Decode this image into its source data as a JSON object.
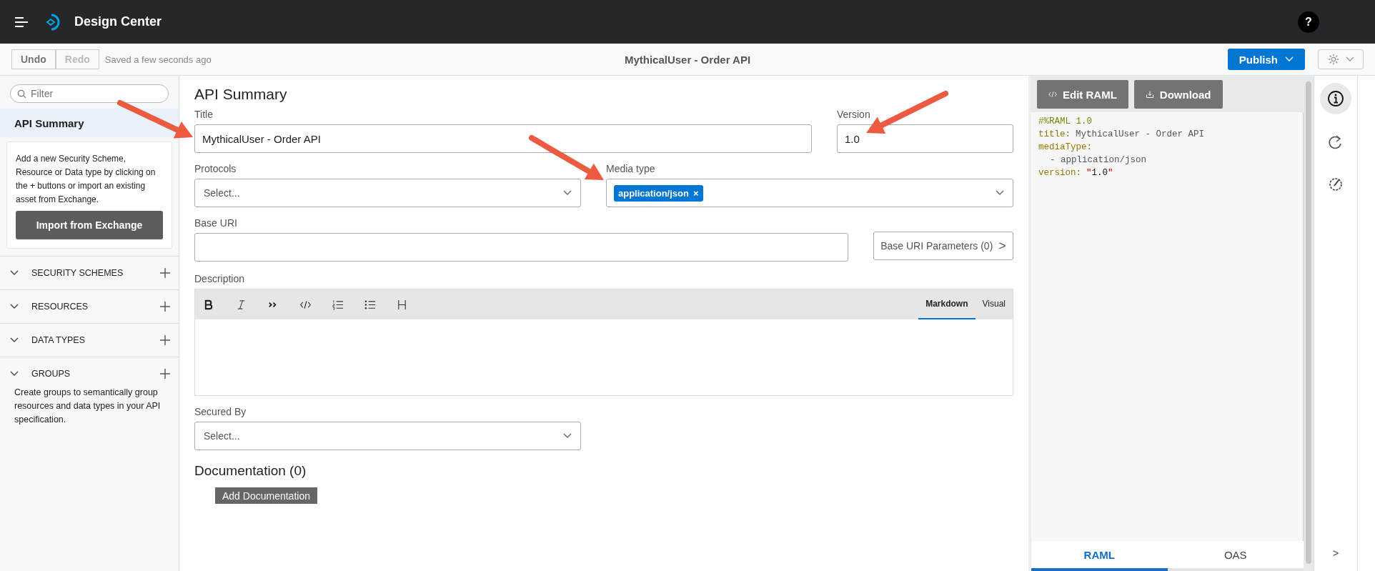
{
  "app": {
    "title": "Design Center",
    "help": "?"
  },
  "toolbar": {
    "buttons": [
      {
        "label": "Undo",
        "disabled": false
      },
      {
        "label": "Redo",
        "disabled": true
      }
    ],
    "status": "Saved a few seconds ago",
    "project_title": "MythicalUser - Order API",
    "publish": "Publish"
  },
  "sidebar": {
    "filter_placeholder": "Filter",
    "items": [
      {
        "label": "API Summary",
        "selected": true
      }
    ],
    "hint": "Add a new Security Scheme, Resource or Data type by clicking on the + buttons or import an existing asset from Exchange.",
    "import_button": "Import from Exchange",
    "sections": [
      {
        "label": "SECURITY SCHEMES"
      },
      {
        "label": "RESOURCES"
      },
      {
        "label": "DATA TYPES"
      },
      {
        "label": "GROUPS",
        "note": "Create groups to semantically group resources and data types in your API specification."
      }
    ]
  },
  "form": {
    "heading": "API Summary",
    "rows": [
      [
        {
          "kind": "text",
          "label": "Title",
          "value": "MythicalUser - Order API"
        },
        {
          "kind": "text",
          "label": "Version",
          "value": "1.0"
        }
      ],
      [
        {
          "kind": "select",
          "label": "Protocols",
          "placeholder": "Select..."
        },
        {
          "kind": "tags",
          "label": "Media type",
          "tags": [
            {
              "text": "application/json",
              "remove": "×"
            }
          ]
        }
      ],
      [
        {
          "kind": "text",
          "label": "Base URI"
        },
        {
          "kind": "button",
          "label": "Base URI Parameters (0)",
          "icon": ">"
        }
      ]
    ],
    "description": {
      "label": "Description",
      "modes": [
        {
          "label": "Markdown",
          "selected": true
        },
        {
          "label": "Visual",
          "selected": false
        }
      ]
    },
    "secured_by": {
      "label": "Secured By",
      "placeholder": "Select..."
    },
    "documentation": {
      "heading": "Documentation (0)",
      "button": "Add Documentation"
    }
  },
  "raml": {
    "buttons": [
      "Edit RAML",
      "Download"
    ],
    "lines": [
      [
        {
          "kind": "directive",
          "text": "#%RAML 1.0"
        }
      ],
      [
        {
          "kind": "key",
          "text": "title:"
        },
        {
          "kind": "plain",
          "text": "MythicalUser - Order API"
        }
      ],
      [
        {
          "kind": "key",
          "text": "mediaType:"
        }
      ],
      [
        {
          "kind": "item",
          "text": "- application/json"
        }
      ],
      [
        {
          "kind": "key",
          "text": "version:"
        },
        {
          "kind": "quote",
          "text": "\""
        },
        {
          "kind": "number",
          "text": "1.0"
        },
        {
          "kind": "quote",
          "text": "\""
        }
      ]
    ],
    "tabs": [
      {
        "label": "RAML",
        "selected": true
      },
      {
        "label": "OAS",
        "selected": false
      }
    ]
  },
  "rail": {
    "items": [
      {
        "kind": "info",
        "selected": true
      },
      {
        "kind": "share",
        "selected": false
      },
      {
        "kind": "gear-edit",
        "selected": false
      }
    ],
    "expand": ">"
  }
}
